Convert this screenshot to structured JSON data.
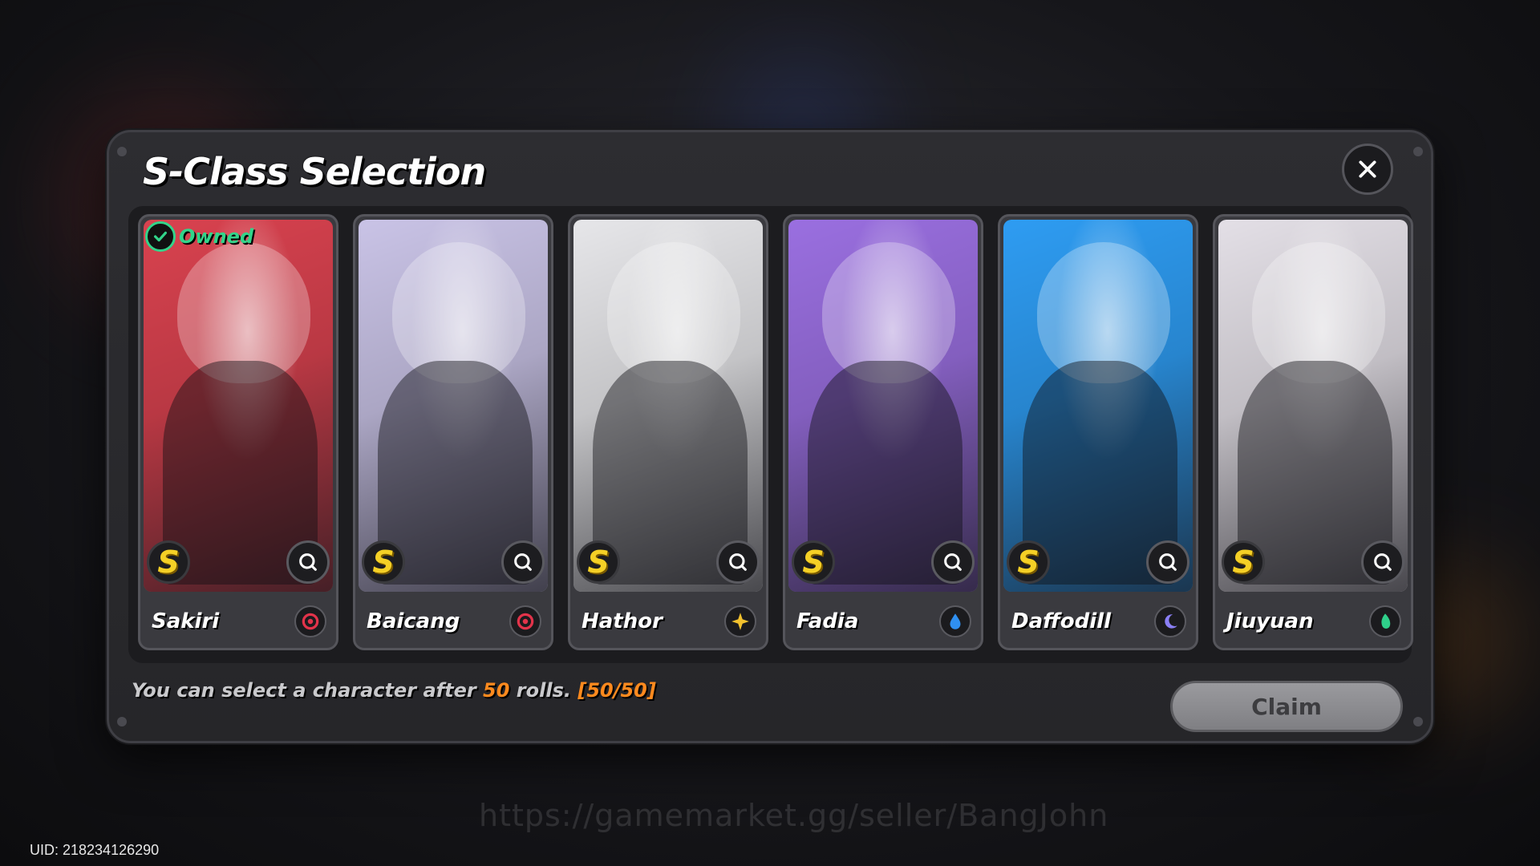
{
  "dialog": {
    "title": "S-Class Selection",
    "close_icon": "close-icon"
  },
  "characters": [
    {
      "name": "Sakiri",
      "owned": true,
      "owned_label": "Owned",
      "rank": "S",
      "element_icon": "target-element-icon",
      "element_color": "#e2334a",
      "bg": "#d9424f"
    },
    {
      "name": "Baicang",
      "owned": false,
      "rank": "S",
      "element_icon": "target-element-icon",
      "element_color": "#e2334a",
      "bg": "#c9c3e6"
    },
    {
      "name": "Hathor",
      "owned": false,
      "rank": "S",
      "element_icon": "star-element-icon",
      "element_color": "#f2c12e",
      "bg": "#e6e6e9"
    },
    {
      "name": "Fadia",
      "owned": false,
      "rank": "S",
      "element_icon": "water-element-icon",
      "element_color": "#2f8ff0",
      "bg": "#9a6fe0"
    },
    {
      "name": "Daffodill",
      "owned": false,
      "rank": "S",
      "element_icon": "moon-element-icon",
      "element_color": "#8a7ff5",
      "bg": "#2e9cf2"
    },
    {
      "name": "Jiuyuan",
      "owned": false,
      "rank": "S",
      "element_icon": "leaf-element-icon",
      "element_color": "#2fcf8a",
      "bg": "#e3dfe6"
    }
  ],
  "footer": {
    "text_before": "You can select a character after ",
    "rolls_value": "50",
    "text_after": " rolls. ",
    "progress": "[50/50]",
    "claim_label": "Claim"
  },
  "watermark": "https://gamemarket.gg/seller/BangJohn",
  "uid": "UID: 218234126290",
  "colors": {
    "highlight": "#ff8a1e",
    "owned": "#32d48a",
    "rank": "#f5d026"
  }
}
